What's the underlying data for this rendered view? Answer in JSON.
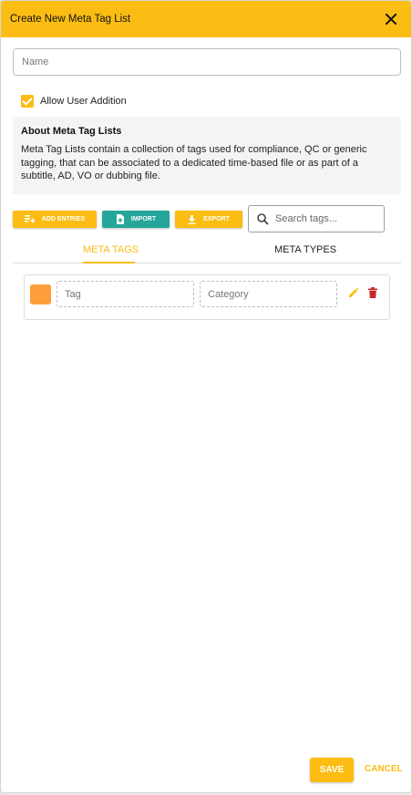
{
  "dialog": {
    "title": "Create New Meta Tag List"
  },
  "form": {
    "name_placeholder": "Name",
    "allow_user_addition_label": "Allow User Addition",
    "allow_user_addition_checked": true
  },
  "about": {
    "title": "About Meta Tag Lists",
    "text": "Meta Tag Lists contain a collection of tags used for compliance, QC or generic tagging, that can be associated to a dedicated time-based file or as part of a subtitle, AD, VO or dubbing file."
  },
  "toolbar": {
    "add_entries_label": "ADD ENTRIES",
    "import_label": "IMPORT",
    "export_label": "EXPORT",
    "search_placeholder": "Search tags..."
  },
  "tabs": [
    {
      "label": "META TAGS",
      "active": true
    },
    {
      "label": "META TYPES",
      "active": false
    }
  ],
  "tag_rows": [
    {
      "color": "#fd9e3a",
      "tag_placeholder": "Tag",
      "category_placeholder": "Category",
      "icons": [
        "pencil-icon",
        "trash-icon"
      ]
    }
  ],
  "footer": {
    "save_label": "SAVE",
    "cancel_label": "CANCEL"
  },
  "colors": {
    "accent": "#fbbd13",
    "import": "#26a69a",
    "delete": "#c62828"
  }
}
